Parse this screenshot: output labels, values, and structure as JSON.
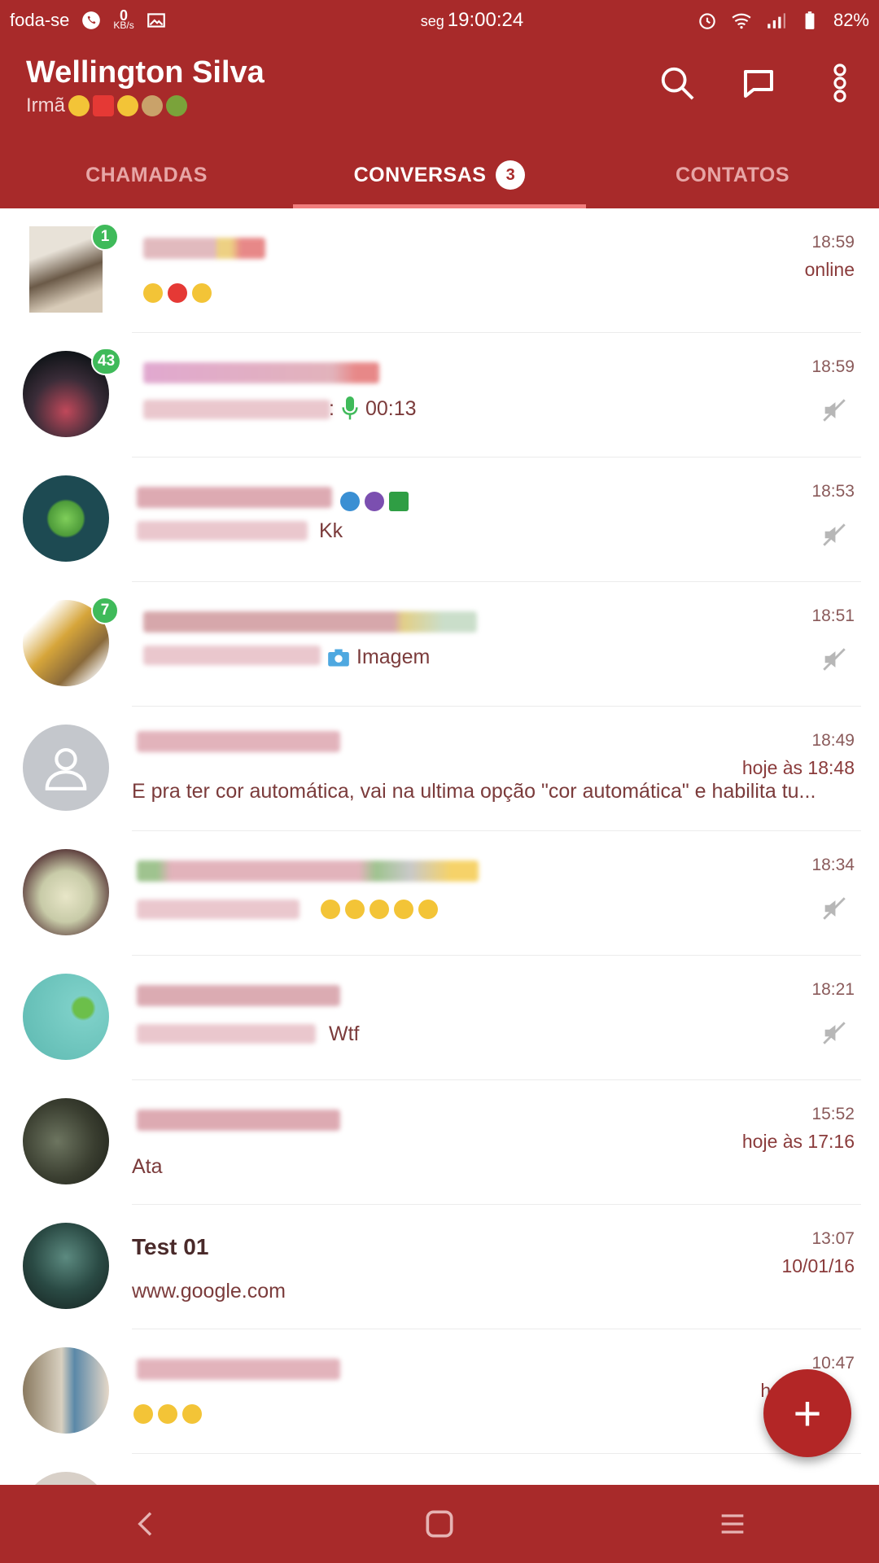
{
  "status_bar": {
    "carrier_text": "foda-se",
    "net_speed_value": "0",
    "net_speed_unit": "KB/s",
    "day": "seg",
    "time": "19:00:24",
    "battery": "82%"
  },
  "header": {
    "contact_name": "Wellington Silva",
    "status_text": "Irmã"
  },
  "tabs": [
    {
      "label": "CHAMADAS",
      "active": false
    },
    {
      "label": "CONVERSAS",
      "active": true,
      "badge": "3"
    },
    {
      "label": "CONTATOS",
      "active": false
    }
  ],
  "chats": [
    {
      "unread": "1",
      "time": "18:59",
      "sub_time": "online",
      "message": ""
    },
    {
      "unread": "43",
      "time": "18:59",
      "message": "00:13",
      "muted": true
    },
    {
      "time": "18:53",
      "message": "Kk",
      "muted": true
    },
    {
      "unread": "7",
      "time": "18:51",
      "message": "Imagem",
      "muted": true
    },
    {
      "time": "18:49",
      "sub_time": "hoje às 18:48",
      "message": "E pra ter cor automática, vai na ultima opção \"cor automática\" e habilita tu..."
    },
    {
      "time": "18:34",
      "message": "",
      "muted": true
    },
    {
      "time": "18:21",
      "message": "Wtf",
      "muted": true
    },
    {
      "time": "15:52",
      "sub_time": "hoje às 17:16",
      "message": "Ata"
    },
    {
      "name": "Test 01",
      "time": "13:07",
      "sub_time": "10/01/16",
      "message": "www.google.com"
    },
    {
      "time": "10:47",
      "sub_time": "ho",
      "message": ""
    }
  ],
  "fab_label": "+",
  "colors": {
    "primary": "#a82a2a",
    "unread_badge": "#3fba5a",
    "fab": "#b32626"
  }
}
